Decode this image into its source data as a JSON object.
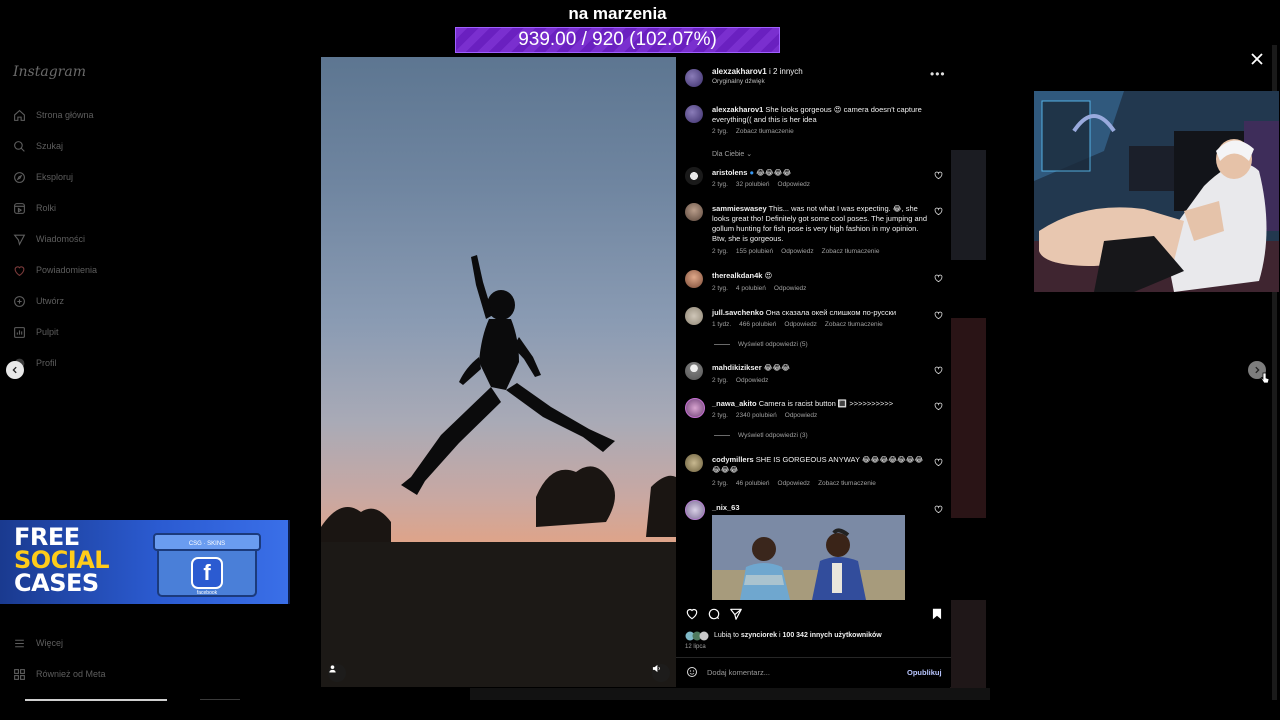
{
  "instagram": {
    "logo": "Instagram",
    "nav": [
      {
        "label": "Strona główna",
        "icon": "home-icon"
      },
      {
        "label": "Szukaj",
        "icon": "search-icon"
      },
      {
        "label": "Eksploruj",
        "icon": "compass-icon"
      },
      {
        "label": "Rolki",
        "icon": "reels-icon"
      },
      {
        "label": "Wiadomości",
        "icon": "messenger-icon"
      },
      {
        "label": "Powiadomienia",
        "icon": "heart-icon"
      },
      {
        "label": "Utwórz",
        "icon": "plus-square-icon"
      },
      {
        "label": "Pulpit",
        "icon": "dashboard-icon"
      },
      {
        "label": "Profil",
        "icon": "profile-avatar-icon"
      }
    ],
    "more": "Więcej",
    "also_meta": "Również od Meta"
  },
  "stream": {
    "goal_title": "na marzenia",
    "goal_progress": "939.00 / 920 (102.07%)",
    "goal_fraction": 1.0207
  },
  "promo": {
    "line1": "FREE",
    "line2": "SOCIAL",
    "line3": "CASES",
    "box_label": "CSG · SKINS",
    "box_brand": "facebook"
  },
  "post": {
    "author": "alexzakharov1",
    "coauthors": "i 2 innych",
    "audio": "Oryginalny dźwięk",
    "caption_user": "alexzakharov1",
    "caption_text": "She looks gorgeous 😍 camera doesn't capture everything(( and this is her idea",
    "caption_age": "2 tyg.",
    "caption_translate": "Zobacz tłumaczenie",
    "sort_label": "Dla Ciebie",
    "comments": [
      {
        "user": "aristolens",
        "verified": true,
        "text": "😂😂😂😂",
        "age": "2 tyg.",
        "likes": "32 polubień",
        "reply": "Odpowiedz",
        "translate": ""
      },
      {
        "user": "sammieswasey",
        "verified": false,
        "text": "This... was not what I was expecting. 😂, she looks great tho! Definitely got some cool poses. The jumping and gollum hunting for fish pose is very high fashion in my opinion. Btw, she is gorgeous.",
        "age": "2 tyg.",
        "likes": "155 polubień",
        "reply": "Odpowiedz",
        "translate": "Zobacz tłumaczenie"
      },
      {
        "user": "therealkdan4k",
        "verified": false,
        "text": "😍",
        "age": "2 tyg.",
        "likes": "4 polubień",
        "reply": "Odpowiedz",
        "translate": ""
      },
      {
        "user": "jull.savchenko",
        "verified": false,
        "text": "Она сказала окей слишком по-русски",
        "age": "1 tydz.",
        "likes": "466 polubień",
        "reply": "Odpowiedz",
        "translate": "Zobacz tłumaczenie",
        "thread": "Wyświetl odpowiedzi (5)"
      },
      {
        "user": "mahdikizikser",
        "verified": false,
        "text": "😂😂😂",
        "age": "2 tyg.",
        "likes": "",
        "reply": "Odpowiedz",
        "translate": ""
      },
      {
        "user": "_nawa_akito",
        "verified": false,
        "text": "Camera is racist button 🔳 >>>>>>>>>>",
        "age": "2 tyg.",
        "likes": "2340 polubień",
        "reply": "Odpowiedz",
        "translate": "",
        "thread": "Wyświetl odpowiedzi (3)"
      },
      {
        "user": "codymillers",
        "verified": false,
        "text": "SHE IS GORGEOUS ANYWAY 😂😂😂😂😂😂😂😂😂😂",
        "age": "2 tyg.",
        "likes": "46 polubień",
        "reply": "Odpowiedz",
        "translate": "Zobacz tłumaczenie"
      },
      {
        "user": "_nix_63",
        "verified": false,
        "text": "",
        "age": "",
        "likes": "",
        "reply": "",
        "translate": ""
      }
    ],
    "likes_prefix": "Lubią to",
    "likes_user": "szynciorek",
    "likes_mid": "i",
    "likes_count": "100 342 innych użytkowników",
    "date": "12 lipca",
    "add_comment_placeholder": "Dodaj komentarz...",
    "publish": "Opublikuj"
  },
  "colors": {
    "goal_bar": "#7a2fcf",
    "publish": "#b9c6ff",
    "promo_blue": "#2b5bd1",
    "promo_yellow": "#ffcc1a"
  }
}
